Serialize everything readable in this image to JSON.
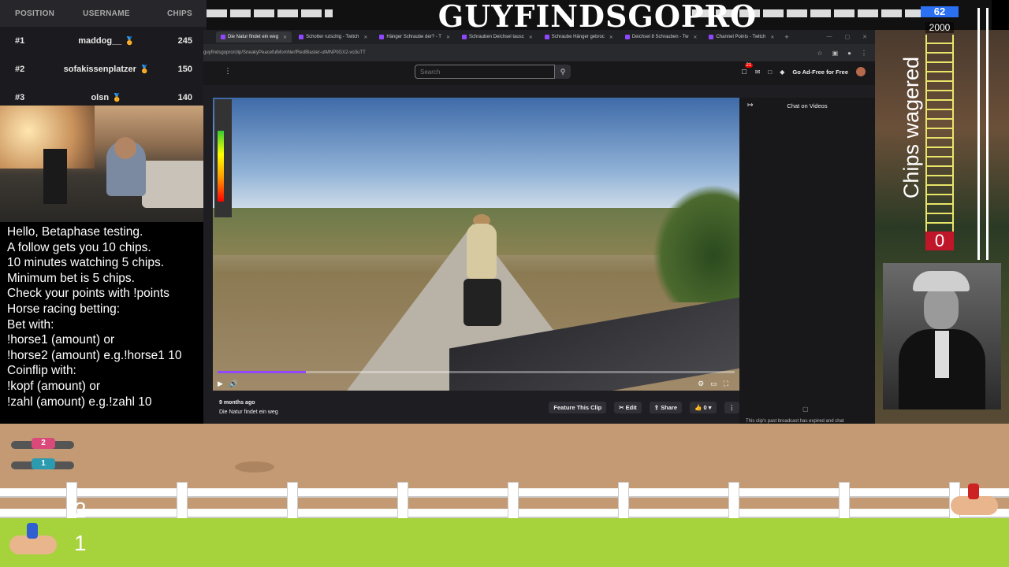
{
  "banner": {
    "title": "GUYFINDSGOPRO"
  },
  "leaderboard": {
    "headers": {
      "position": "POSITION",
      "username": "USERNAME",
      "chips": "CHIPS"
    },
    "rows": [
      {
        "pos": "#1",
        "user": "maddog__",
        "chips": "245"
      },
      {
        "pos": "#2",
        "user": "sofakissenplatzer",
        "chips": "150"
      },
      {
        "pos": "#3",
        "user": "olsn",
        "chips": "140"
      }
    ]
  },
  "info": {
    "lines": [
      "Hello, Betaphase testing.",
      "A follow gets you 10 chips.",
      "10 minutes watching 5 chips.",
      "Minimum bet is 5 chips.",
      "Check your points with !points",
      "Horse racing betting:",
      "Bet with:",
      "!horse1 (amount) or",
      "!horse2 (amount) e.g.!horse1 10",
      "Coinflip with:",
      "!kopf (amount) or",
      "!zahl (amount) e.g.!zahl 10"
    ]
  },
  "browser": {
    "tabs": [
      "Die Natur findet ein weg",
      "Schotter rutschig - Twitch",
      "Hänger Schraube der? - T",
      "Schrauben Deichsel tausc",
      "Schraube Hänger gebroc",
      "Deichsel 8 Schrauben - Tw",
      "Channel Points - Twitch"
    ],
    "url": "guyfindsgopro/clip/SneakyPeacefulMomNerfRedBlaster-utMNP0GX2-vo3uTT",
    "search_placeholder": "Search",
    "notif_count": "21",
    "adfree_label": "Go Ad-Free for Free",
    "video": {
      "progress": 0.17
    },
    "clip_age": "9 months ago",
    "clip_title": "Die Natur findet ein weg",
    "actions": {
      "feature": "Feature This Clip",
      "edit": "Edit",
      "share": "Share",
      "likes": "0"
    },
    "chat_header": "Chat on Videos",
    "chat_expired": "This clip's past broadcast has expired and chat"
  },
  "wager": {
    "label": "Chips wagered",
    "top": "62",
    "max": "2000",
    "current": "0"
  },
  "race": {
    "lane2": "2",
    "lane1": "1",
    "dog_top": "2",
    "dog_bottom": "1"
  },
  "colors": {
    "accent": "#9147ff",
    "meter_top": "#2b6ff2",
    "meter_zero": "#c0162a",
    "grass": "#a6d23c"
  }
}
